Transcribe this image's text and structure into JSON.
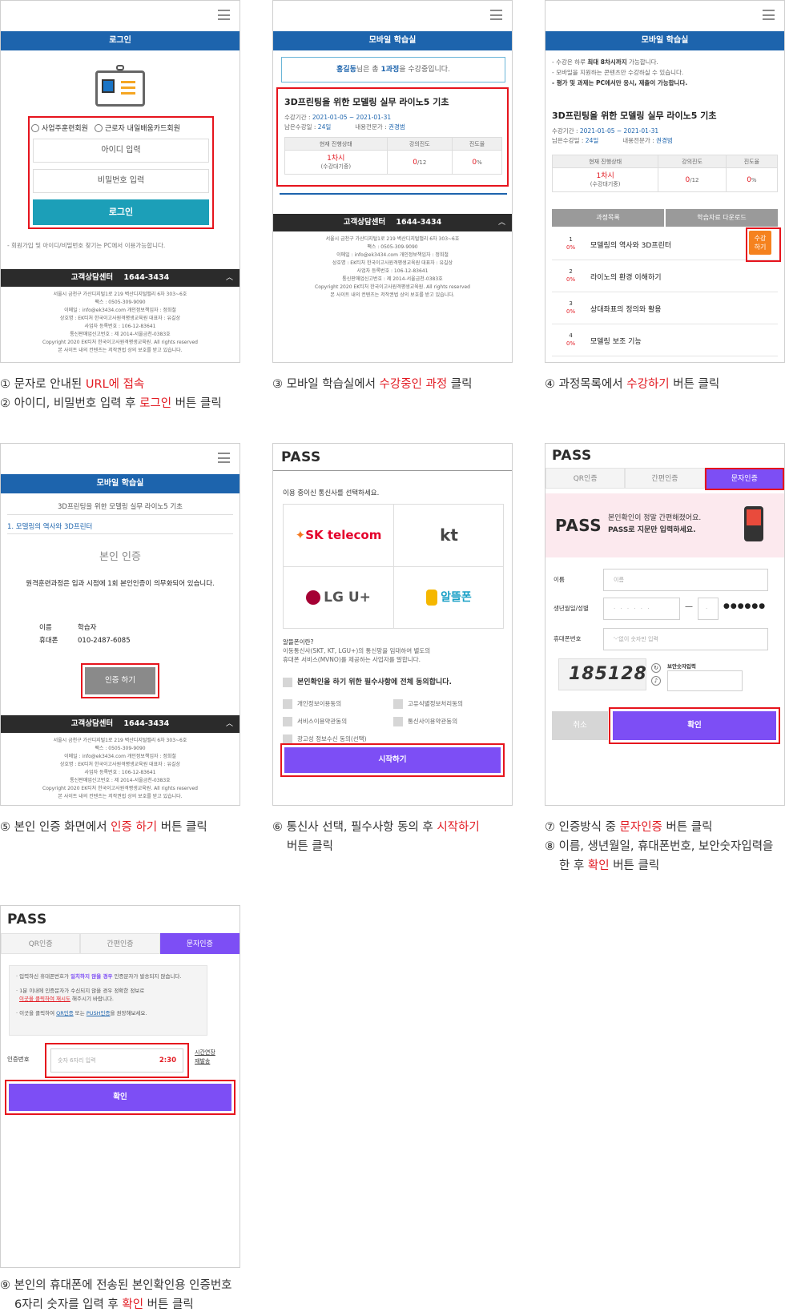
{
  "p1": {
    "header": "로그인",
    "radio1": "사업주훈련회원",
    "radio2": "근로자 내일배움카드회원",
    "id_ph": "아이디 입력",
    "pw_ph": "비밀번호 입력",
    "login_btn": "로그인",
    "note": "- 회원가입 및 아이디/비밀번호 찾기는 PC에서 이용가능합니다."
  },
  "footer": {
    "label": "고객상담센터",
    "phone": "1644-3434",
    "lines": [
      "서울시 금천구 가산디지털1로 219 벽산디지털밸리 6차 303~6호",
      "팩스 : 0505-309-9090",
      "이메일 : info@ek3434.com 개인정보책임자 : 정희철",
      "상호명 : EK티처 한국이고사원격평생교육원 대표자 : 유길상",
      "사업자 등록번호 : 106-12-83641",
      "통신판매업신고번호 : 제 2014-서울금천-0383호",
      "Copyright 2020 EK티처 한국이고사원격평생교육원. All rights reserved",
      "본 사이트 내의 컨텐츠는 저작권법 상의 보호를 받고 있습니다."
    ]
  },
  "p2": {
    "header": "모바일 학습실",
    "notice_name": "홍길동",
    "notice_mid": "님은 총 ",
    "notice_count": "1과정",
    "notice_end": "을 수강중입니다.",
    "course_title": "3D프린팅을 위한 모델링 실무 라이노5 기초",
    "period_label": "수강기간 : ",
    "period": "2021-01-05 ~ 2021-01-31",
    "remain_label": "남은수강일 : ",
    "remain": "24일",
    "tutor_label": "내용전문가 : ",
    "tutor": "권경범",
    "th_status": "현재 진행상태",
    "th_progress": "강의진도",
    "th_rate": "진도율",
    "td_status": "1차시",
    "td_status_sub": "(수강대기중)",
    "td_progress": "0",
    "td_progress_total": "/12",
    "td_rate": "0",
    "pct": "%"
  },
  "p3": {
    "header": "모바일 학습실",
    "n1": "- 수강은 하루 ",
    "n1b": "최대 8차시까지",
    "n1e": " 가능합니다.",
    "n2": "- 모바일을 지원하는 콘텐츠만 수강하실 수 있습니다.",
    "n3": "- 평가 및 과제는 PC에서만 응시, 제출이 가능합니다.",
    "list_head": "과정목록",
    "dl_head": "학습자료 다운로드",
    "lessons": [
      {
        "no": "1",
        "title": "모델링의 역사와 3D프린터"
      },
      {
        "no": "2",
        "title": "라이노의 환경 이해하기"
      },
      {
        "no": "3",
        "title": "상대좌표의 정의와 활용"
      },
      {
        "no": "4",
        "title": "모델링 보조 기능"
      }
    ],
    "btn1": "수강",
    "btn2": "하기"
  },
  "p4": {
    "header": "모바일 학습실",
    "course": "3D프린팅을 위한 모델링 실무 라이노5 기초",
    "lesson": "1. 모델링의 역사와 3D프린터",
    "title": "본인 인증",
    "msg": "원격훈련과정은 입과 시점에 1회 본인인증이 의무화되어 있습니다.",
    "name_label": "이름",
    "name": "학습자",
    "phone_label": "휴대폰",
    "phone": "010-2487-6085",
    "btn": "인증 하기"
  },
  "p5": {
    "logo": "PASS",
    "title": "이용 중이신 통신사를 선택하세요.",
    "carriers": [
      "SK telecom",
      "kt",
      "LG U+",
      "알뜰폰"
    ],
    "mvno_q": "알뜰폰이란?",
    "mvno_desc1": "이동통신사(SKT, KT, LGU+)의 통신망을 임대하여 별도의",
    "mvno_desc2": "휴대폰 서비스(MVNO)를 제공하는 사업자를 말합니다.",
    "agree_all": "본인확인을 하기 위한 필수사항에 전체 동의합니다.",
    "agrees": [
      "개인정보이용동의",
      "고유식별정보처리동의",
      "서비스이용약관동의",
      "통신사이용약관동의",
      "광고성 정보수신 동의(선택)"
    ],
    "start": "시작하기"
  },
  "p6": {
    "logo": "PASS",
    "tabs": [
      "QR인증",
      "간편인증",
      "문자인증"
    ],
    "banner1": "본인확인이 정말 간편해졌어요.",
    "banner2": "PASS로 지문만 입력하세요.",
    "name_label": "이름",
    "name_ph": "이름",
    "birth_label": "생년월일/성별",
    "birth_ph": "· · · · · ·",
    "gender_ph": "·",
    "masked": "●●●●●●",
    "phone_label": "휴대폰번호",
    "phone_ph": "'-'없이 숫자만 입력",
    "captcha": "185128",
    "captcha_label": "보안숫자입력",
    "cancel": "취소",
    "ok": "확인"
  },
  "p7": {
    "logo": "PASS",
    "tabs": [
      "QR인증",
      "간편인증",
      "문자인증"
    ],
    "b1a": "· 입력하신 휴대폰번호가 ",
    "b1b": "일치하지 않을 경우",
    "b1c": " 인증문자가 발송되지 않습니다.",
    "b2a": "· 1분 이내에 인증문자가 수신되지 않을 경우 정확한 정보로",
    "b2b": "이곳을 클릭하여 재시도",
    "b2c": " 해주시기 바랍니다.",
    "b3a": "· 이곳을 클릭하여 ",
    "b3b": "QR인증",
    "b3c": " 또는 ",
    "b3d": "PUSH인증",
    "b3e": "을 권장해보세요.",
    "code_label": "인증번호",
    "code_ph": "숫자 6자리 입력",
    "timer": "2:30",
    "extend": "시간연장",
    "resend": "재발송",
    "ok": "확인"
  },
  "captions": {
    "c1a": "① 문자로 안내된 ",
    "c1b": "URL에 접속",
    "c2a": "② 아이디, 비밀번호 입력 후 ",
    "c2b": "로그인",
    "c2c": " 버튼 클릭",
    "c3a": "③ 모바일 학습실에서 ",
    "c3b": "수강중인 과정",
    "c3c": " 클릭",
    "c4a": "④ 과정목록에서 ",
    "c4b": "수강하기",
    "c4c": " 버튼 클릭",
    "c5a": "⑤ 본인 인증 화면에서 ",
    "c5b": "인증 하기",
    "c5c": " 버튼 클릭",
    "c6a": "⑥ 통신사 선택, 필수사항 동의 후 ",
    "c6b": "시작하기",
    "c6c": "버튼 클릭",
    "c7a": "⑦ 인증방식 중 ",
    "c7b": "문자인증",
    "c7c": " 버튼 클릭",
    "c8a": "⑧ 이름, 생년월일, 휴대폰번호, 보안숫자입력을",
    "c8b": "한 후 ",
    "c8c": "확인",
    "c8d": " 버튼 클릭",
    "c9a": "⑨ 본인의 휴대폰에 전송된 본인확인용 인증번호",
    "c9b": "6자리 숫자를 입력 후 ",
    "c9c": "확인",
    "c9d": " 버튼 클릭"
  },
  "colors": {
    "blue": "#1d64ad",
    "red": "#e21b23",
    "purple": "#7d4ef5",
    "orange": "#f5821f",
    "teal": "#1c9fb8"
  }
}
